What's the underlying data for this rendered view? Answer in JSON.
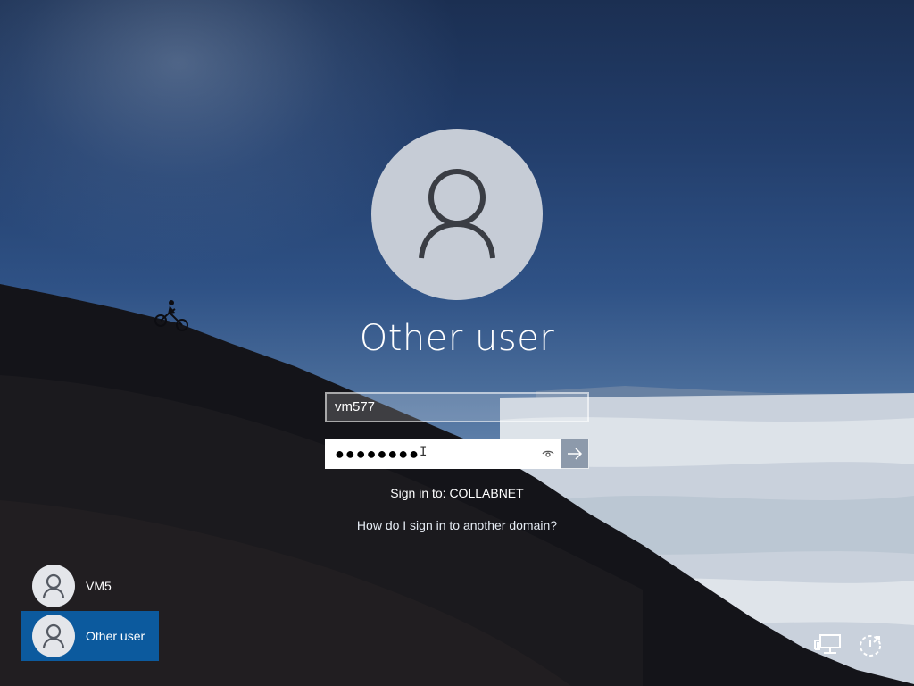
{
  "login": {
    "user_title": "Other user",
    "username_value": "vm577",
    "password_masked": "●●●●●●●●",
    "text_cursor": "I",
    "signin_to": "Sign in to: COLLABNET",
    "domain_help_link": "How do I sign in to another domain?"
  },
  "user_list": [
    {
      "label": "VM5",
      "selected": false
    },
    {
      "label": "Other user",
      "selected": true
    }
  ],
  "icons": {
    "avatar": "person-silhouette-icon",
    "reveal_password": "eye-icon",
    "submit": "arrow-right-icon",
    "network": "network-icon",
    "power": "power-icon"
  },
  "colors": {
    "selected_user_bg": "#0c5a9e",
    "avatar_bg": "#c6ccd6"
  }
}
